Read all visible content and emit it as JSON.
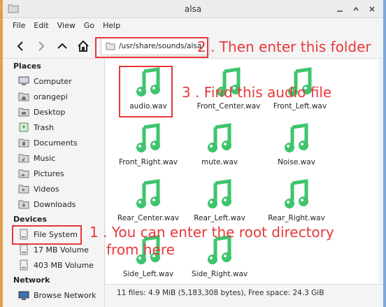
{
  "window": {
    "title": "alsa"
  },
  "menubar": {
    "items": [
      "File",
      "Edit",
      "View",
      "Go",
      "Help"
    ]
  },
  "toolbar": {
    "path": "/usr/share/sounds/alsa/"
  },
  "sidebar": {
    "places_header": "Places",
    "places": [
      "Computer",
      "orangepi",
      "Desktop",
      "Trash",
      "Documents",
      "Music",
      "Pictures",
      "Videos",
      "Downloads"
    ],
    "devices_header": "Devices",
    "devices": [
      "File System",
      "17 MB Volume",
      "403 MB Volume"
    ],
    "network_header": "Network",
    "network": [
      "Browse Network"
    ]
  },
  "files": [
    "audio.wav",
    "Front_Center.wav",
    "Front_Left.wav",
    "Front_Right.wav",
    "mute.wav",
    "Noise.wav",
    "Rear_Center.wav",
    "Rear_Left.wav",
    "Rear_Right.wav",
    "Side_Left.wav",
    "Side_Right.wav"
  ],
  "status": {
    "text": "11 files: 4.9 MiB (5,183,308 bytes), Free space: 24.3 GiB"
  },
  "annotations": {
    "step1": "1 . You can enter the root directory",
    "step1b": "from here",
    "step2": "2 . Then enter this folder",
    "step3": "3 . Find this audio file"
  },
  "colors": {
    "annotation": "#e8383a",
    "music_icon": "#3ec46d"
  }
}
